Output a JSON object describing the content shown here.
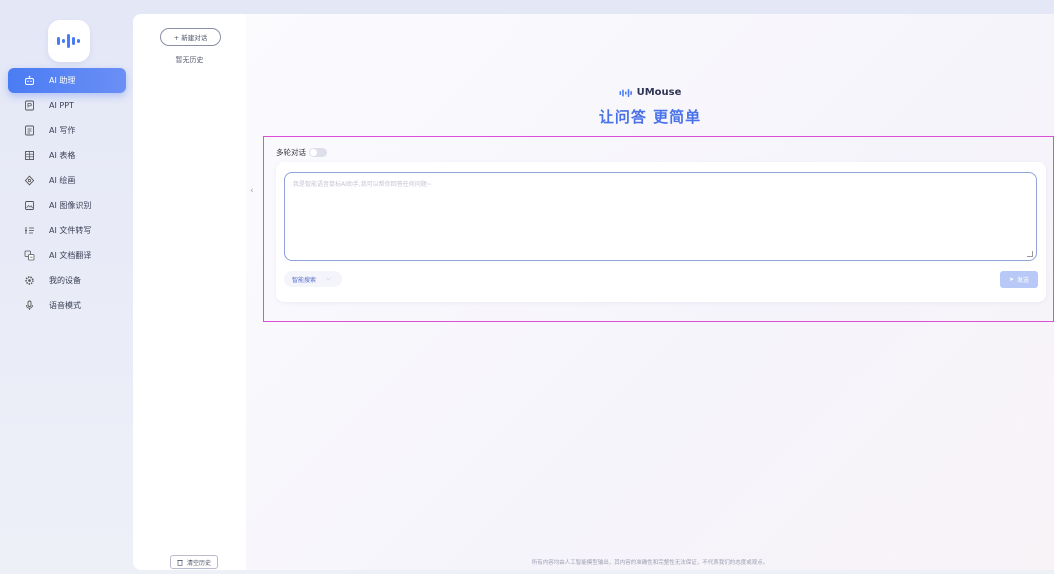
{
  "nav": {
    "items": [
      {
        "label": "AI 助理",
        "icon": "robot-icon",
        "active": true
      },
      {
        "label": "AI PPT",
        "icon": "ppt-icon",
        "active": false
      },
      {
        "label": "AI 写作",
        "icon": "document-icon",
        "active": false
      },
      {
        "label": "AI 表格",
        "icon": "table-icon",
        "active": false
      },
      {
        "label": "AI 绘画",
        "icon": "palette-icon",
        "active": false
      },
      {
        "label": "AI 图像识别",
        "icon": "image-scan-icon",
        "active": false
      },
      {
        "label": "AI 文件转写",
        "icon": "transcribe-icon",
        "active": false
      },
      {
        "label": "AI 文档翻译",
        "icon": "translate-icon",
        "active": false
      },
      {
        "label": "我的设备",
        "icon": "device-gear-icon",
        "active": false
      },
      {
        "label": "语音模式",
        "icon": "microphone-icon",
        "active": false
      }
    ]
  },
  "history": {
    "new_chat_label": "+ 新建对话",
    "empty_label": "暂无历史",
    "clear_label": "清空历史"
  },
  "main": {
    "brand_name": "UMouse",
    "slogan": "让问答 更简单",
    "multi_turn_label": "多轮对话",
    "multi_turn_enabled": false,
    "input_placeholder": "我是智能语音鼠标AI助手,我可以帮你回答任何问题~",
    "smart_search_label": "智能搜索",
    "send_label": "发送",
    "footer_note": "所有内容均由人工智能模型输出，其内容的准确性和完整性无法保证，不代表我们的态度或观点。"
  },
  "colors": {
    "accent": "#4a7cf3",
    "highlight_border": "#d94fd8",
    "send_disabled": "#b9c9f7"
  }
}
